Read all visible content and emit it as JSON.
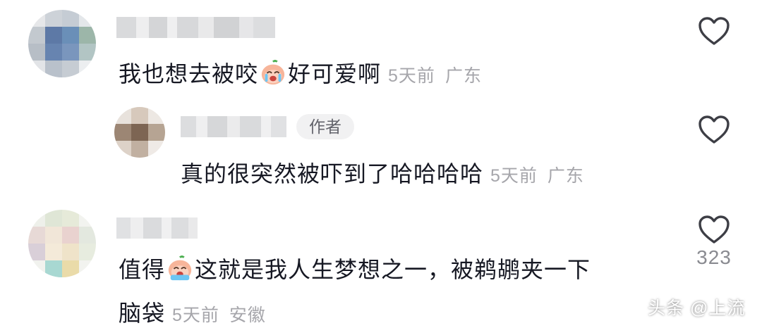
{
  "comments": [
    {
      "text_before": "我也想去被咬",
      "text_after": "好可爱啊",
      "time": "5天前",
      "location": "广东",
      "emoji": "crying-peach-emoji",
      "likes": ""
    },
    {
      "badge": "作者",
      "text": "真的很突然被吓到了哈哈哈哈",
      "time": "5天前",
      "location": "广东",
      "likes": ""
    },
    {
      "text_before": "值得",
      "text_after": "这就是我人生梦想之一，被鹈鹕夹一下",
      "text_line2": "脑袋",
      "time": "5天前",
      "location": "安徽",
      "emoji": "crying-peach-emoji",
      "likes": "323"
    }
  ],
  "watermark": "头条 @上流",
  "colors": {
    "text": "#161823",
    "meta": "#a6a6ab",
    "heart_outline": "#3d3e45",
    "badge_bg": "#f1f1f2"
  },
  "icons": [
    "heart-outline-icon",
    "crying-peach-emoji"
  ]
}
